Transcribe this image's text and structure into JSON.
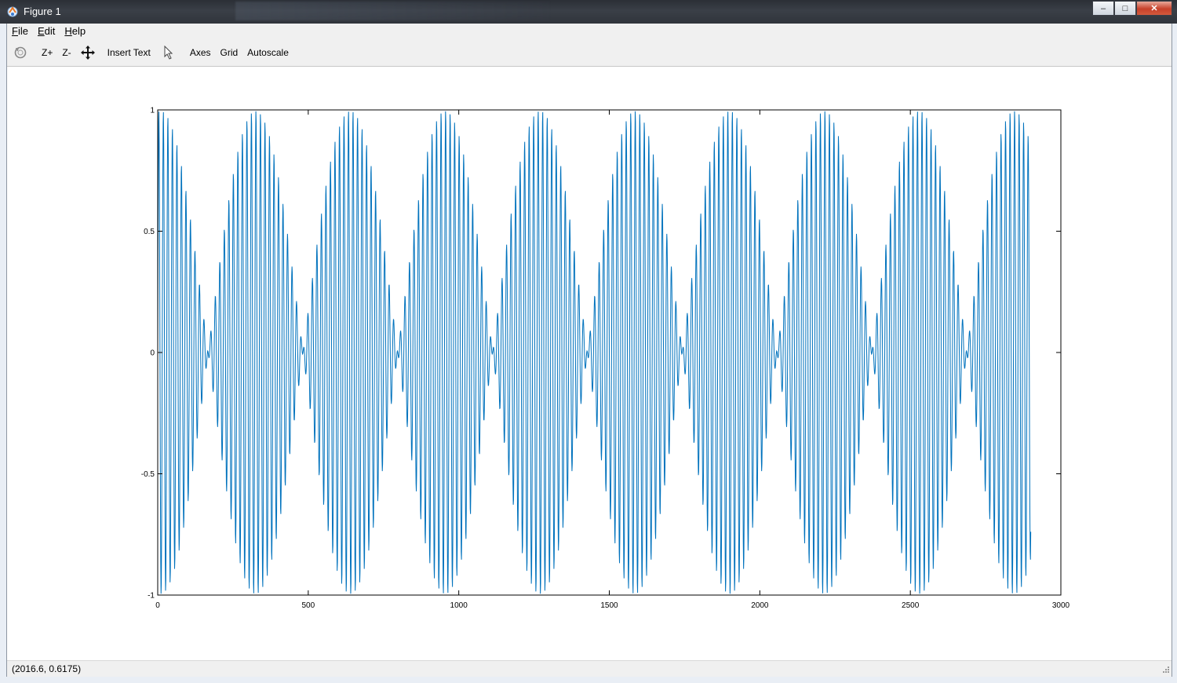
{
  "window": {
    "title": "Figure 1",
    "minimize_label": "‒",
    "maximize_label": "□",
    "close_label": "✕"
  },
  "menu": {
    "items": [
      {
        "label": "File",
        "accel": "F",
        "rest": "ile"
      },
      {
        "label": "Edit",
        "accel": "E",
        "rest": "dit"
      },
      {
        "label": "Help",
        "accel": "H",
        "rest": "elp"
      }
    ]
  },
  "toolbar": {
    "rotate_icon": "rotate-icon",
    "zoom_in_label": "Z+",
    "zoom_out_label": "Z-",
    "pan_icon": "pan-icon",
    "insert_text_label": "Insert Text",
    "select_icon": "pointer-icon",
    "axes_label": "Axes",
    "grid_label": "Grid",
    "autoscale_label": "Autoscale"
  },
  "status": {
    "coordinates": "(2016.6, 0.6175)"
  },
  "chart_data": {
    "type": "line",
    "title": "",
    "xlabel": "",
    "ylabel": "",
    "xlim": [
      0,
      3000
    ],
    "ylim": [
      -1,
      1
    ],
    "xticks": [
      "0",
      "500",
      "1000",
      "1500",
      "2000",
      "2500",
      "3000"
    ],
    "yticks": [
      "1",
      "0.5",
      "0",
      "-0.5",
      "-1"
    ],
    "grid": false,
    "line_color": "#0072bd",
    "series": [
      {
        "description_formula": "y = sin(2*pi*x/15) * cos(pi*x/315 - 0.1)",
        "x_start": 0,
        "x_end": 2900,
        "x_step": 1,
        "carrier_period": 15,
        "envelope_period": 630,
        "envelope_phase": 0.1
      }
    ]
  }
}
